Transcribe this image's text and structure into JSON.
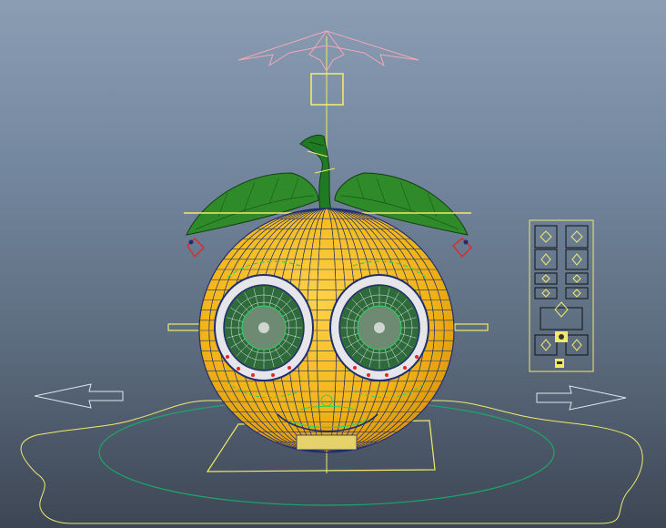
{
  "viewport": {
    "label": "",
    "colors": {
      "background_top": "#8a9db3",
      "background_bottom": "#3d4654",
      "fruit_body": "#f2b417",
      "wireframe": "#1f2f6e",
      "leaf": "#2f8a2a",
      "stem": "#1f7a23",
      "control_yellow": "#f0ea6a",
      "control_white": "#dfe6ee",
      "control_pink": "#f2a8b8",
      "control_red": "#e02828",
      "ground_circle": "#1aa86a",
      "eye_ring_white": "#e6e6ea",
      "iris_green": "#2f6a3a"
    }
  },
  "scene_objects": {
    "fruit_mesh": "orange-character-mesh",
    "rig_controls": [
      "top-star-control",
      "head-square-control",
      "left-ear-control",
      "right-ear-control",
      "root-ground-control",
      "left-move-arrow",
      "right-move-arrow",
      "side-handle-left",
      "side-handle-right"
    ],
    "facial_ui_panel": "facial-picker-panel"
  }
}
